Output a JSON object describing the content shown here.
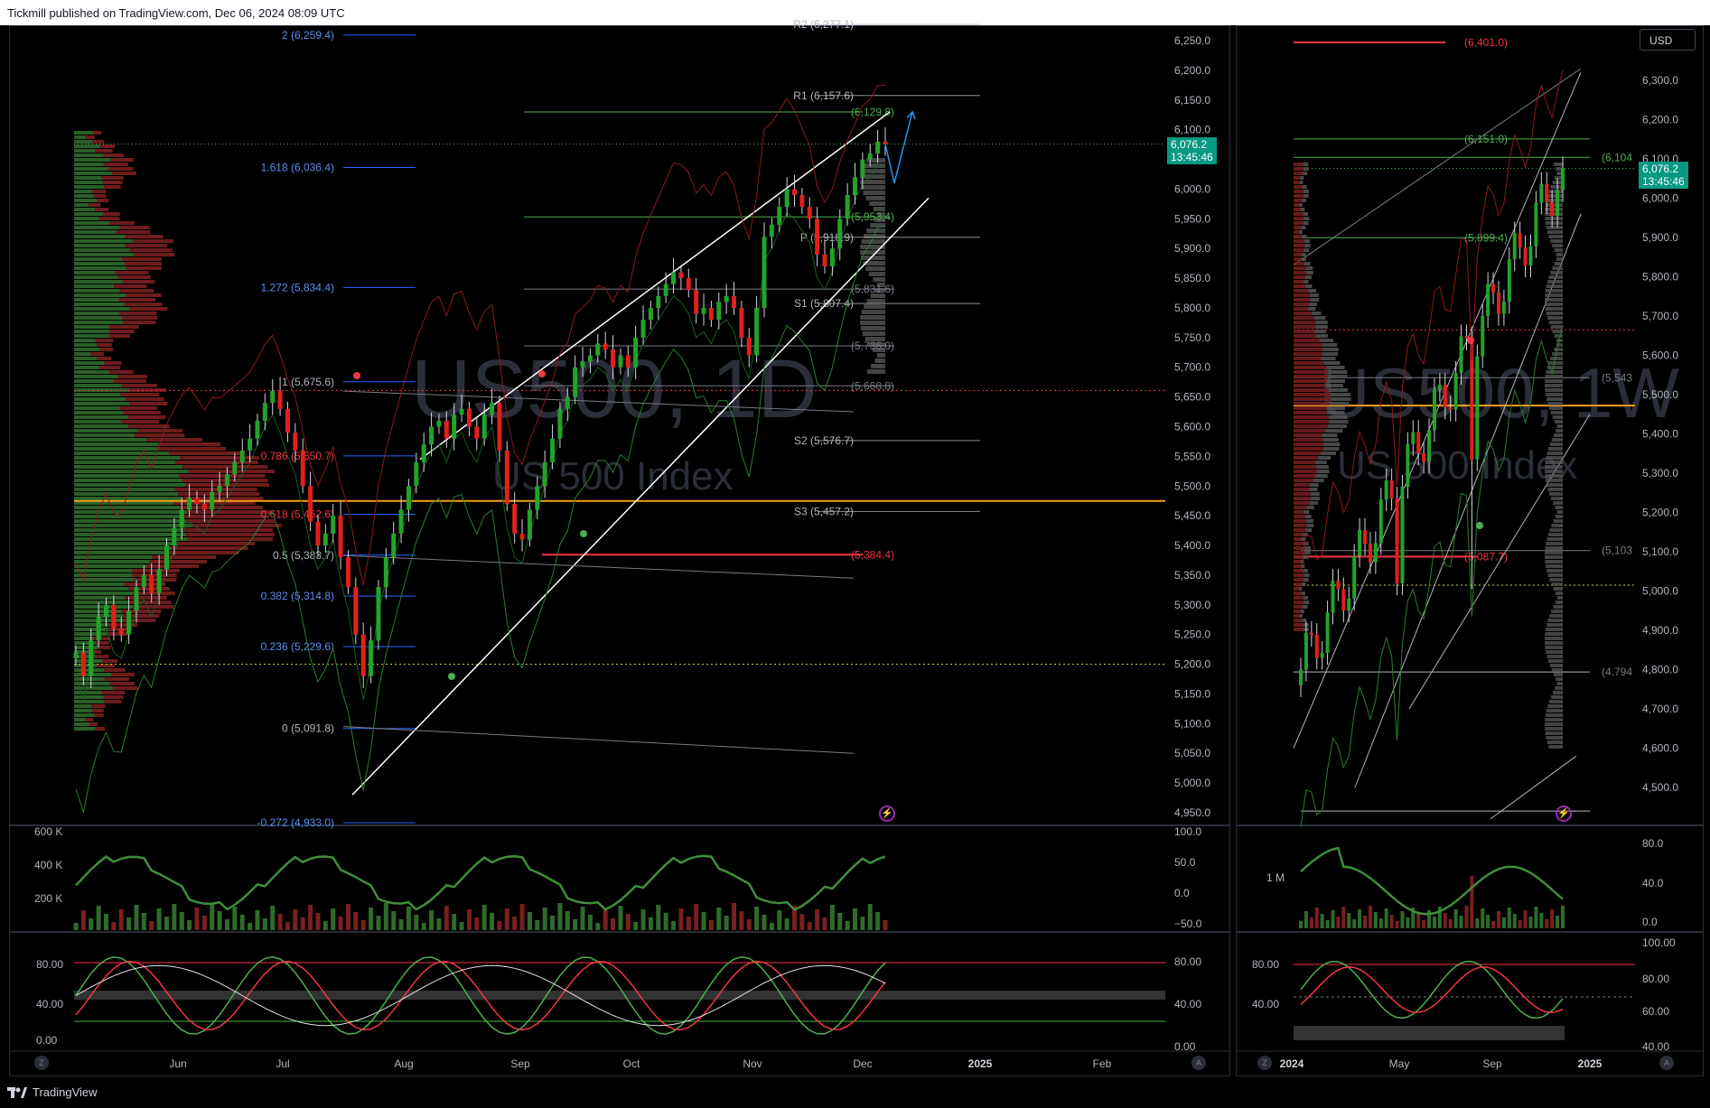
{
  "header": {
    "published": "Tickmill published on TradingView.com, Dec 06, 2024 08:09 UTC"
  },
  "footer": {
    "brand": "TradingView"
  },
  "currency_button": "USD",
  "colors": {
    "up": "#089981",
    "down": "#f23645",
    "bull_candle": "#22a32a",
    "bear_candle": "#e0201b",
    "orange_line": "#f0a020",
    "fib_blue": "#2962ff",
    "pivot_gray": "#b2b5be",
    "green_level": "#4caf50"
  },
  "icons": {
    "zoom_left": "Z",
    "zoom_right": "A",
    "flash": "⚡"
  },
  "left": {
    "watermark_symbol": "US500, 1D",
    "watermark_name": "US 500 Index",
    "price_axis": [
      "6,250.0",
      "6,200.0",
      "6,150.0",
      "6,100.0",
      "6,050.0",
      "6,000.0",
      "5,950.0",
      "5,900.0",
      "5,850.0",
      "5,800.0",
      "5,750.0",
      "5,700.0",
      "5,650.0",
      "5,600.0",
      "5,550.0",
      "5,500.0",
      "5,450.0",
      "5,400.0",
      "5,350.0",
      "5,300.0",
      "5,250.0",
      "5,200.0",
      "5,150.0",
      "5,100.0",
      "5,050.0",
      "5,000.0",
      "4,950.0"
    ],
    "last_price": "6,076.2",
    "countdown": "13:45:46",
    "time_axis": [
      "Jun",
      "Jul",
      "Aug",
      "Sep",
      "Oct",
      "Nov",
      "Dec",
      "2025",
      "Feb"
    ],
    "fib_labels": [
      "2 (6,259.4)",
      "1.618 (6,036.4)",
      "1.272 (5,834.4)",
      "1 (5,675.6)",
      "0.786 (5,550.7)",
      "0.618 (5,452.6)",
      "0.5 (5,383.7)",
      "0.382 (5,314.8)",
      "0.236 (5,229.6)",
      "0 (5,091.8)",
      "-0.272 (4,933.0)"
    ],
    "pivot_labels": [
      "R2 (6,277.1)",
      "R1 (6,157.6)",
      "P (5,918.9)",
      "S1 (5,807.4)",
      "S2 (5,576.7)",
      "S3 (5,457.2)"
    ],
    "level_labels": [
      "(6,129.8)",
      "(5,953.4)",
      "(5,831.6)",
      "(5,736.0)",
      "(5,668.8)",
      "(5,384.4)"
    ],
    "volume_axis": [
      "600 K",
      "400 K",
      "200 K"
    ],
    "rsi_axis": [
      "100.0",
      "50.0",
      "0.0",
      "−50.0"
    ],
    "stoch_axis_left": [
      "80.00",
      "40.00",
      "0.00"
    ],
    "stoch_axis_right": [
      "80.00",
      "40.00",
      "0.00"
    ]
  },
  "right": {
    "watermark_symbol": "US500, 1W",
    "watermark_name": "US 500 Index",
    "price_axis": [
      "6,300.0",
      "6,200.0",
      "6,100.0",
      "6,000.0",
      "5,900.0",
      "5,800.0",
      "5,700.0",
      "5,600.0",
      "5,500.0",
      "5,400.0",
      "5,300.0",
      "5,200.0",
      "5,100.0",
      "5,000.0",
      "4,900.0",
      "4,800.0",
      "4,700.0",
      "4,600.0",
      "4,500.0"
    ],
    "last_price": "6,076.2",
    "countdown": "13:45:46",
    "time_axis": [
      "2024",
      "May",
      "Sep",
      "2025"
    ],
    "level_labels": [
      "(6,401.0)",
      "(6,151.0)",
      "(6,104",
      "(5,899.4)",
      "(5,543",
      "(5,103",
      "(5,087.7)",
      "(4,794"
    ],
    "volume_axis": [
      "1 M"
    ],
    "rsi_axis": [
      "80.0",
      "40.0",
      "0.0"
    ],
    "stoch_axis_left": [
      "80.00",
      "40.00"
    ],
    "stoch_axis_right": [
      "100.00",
      "80.00",
      "60.00",
      "40.00"
    ]
  },
  "chart_data": [
    {
      "type": "candlestick",
      "title": "US500, 1D",
      "subtitle": "US 500 Index",
      "ylim": [
        4930,
        6270
      ],
      "x_ticks": [
        "Jun",
        "Jul",
        "Aug",
        "Sep",
        "Oct",
        "Nov",
        "Dec",
        "2025",
        "Feb"
      ],
      "last_close": 6076.2,
      "fib_levels": [
        6259.4,
        6036.4,
        5834.4,
        5675.6,
        5550.7,
        5452.6,
        5383.7,
        5314.8,
        5229.6,
        5091.8,
        4933.0
      ],
      "pivots": {
        "R2": 6277.1,
        "R1": 6157.6,
        "P": 5918.9,
        "S1": 5807.4,
        "S2": 5576.7,
        "S3": 5457.2
      },
      "horizontal_levels": [
        6129.8,
        5953.4,
        5831.6,
        5736.0,
        5668.8,
        5384.4
      ],
      "close_approx": [
        5220,
        5180,
        5240,
        5280,
        5300,
        5260,
        5250,
        5290,
        5330,
        5350,
        5320,
        5360,
        5400,
        5430,
        5460,
        5480,
        5470,
        5460,
        5490,
        5500,
        5520,
        5540,
        5560,
        5580,
        5610,
        5640,
        5660,
        5630,
        5590,
        5560,
        5500,
        5440,
        5400,
        5420,
        5450,
        5380,
        5330,
        5250,
        5180,
        5240,
        5330,
        5380,
        5420,
        5460,
        5500,
        5540,
        5570,
        5600,
        5610,
        5580,
        5620,
        5630,
        5600,
        5580,
        5620,
        5640,
        5560,
        5470,
        5420,
        5410,
        5460,
        5500,
        5540,
        5580,
        5630,
        5650,
        5700,
        5710,
        5720,
        5740,
        5730,
        5700,
        5720,
        5700,
        5750,
        5780,
        5800,
        5820,
        5840,
        5860,
        5850,
        5830,
        5790,
        5800,
        5780,
        5810,
        5820,
        5800,
        5750,
        5720,
        5800,
        5920,
        5940,
        5970,
        6000,
        5990,
        5970,
        5950,
        5890,
        5870,
        5900,
        5950,
        5990,
        6020,
        6050,
        6060,
        6080,
        6076
      ]
    },
    {
      "type": "candlestick",
      "title": "US500, 1W",
      "subtitle": "US 500 Index",
      "ylim": [
        4430,
        6340
      ],
      "x_ticks": [
        "2024",
        "May",
        "Sep",
        "2025"
      ],
      "last_close": 6076.2,
      "horizontal_levels": [
        6401.0,
        6151.0,
        6104,
        5899.4,
        5543,
        5103,
        5087.7,
        4794
      ]
    }
  ]
}
